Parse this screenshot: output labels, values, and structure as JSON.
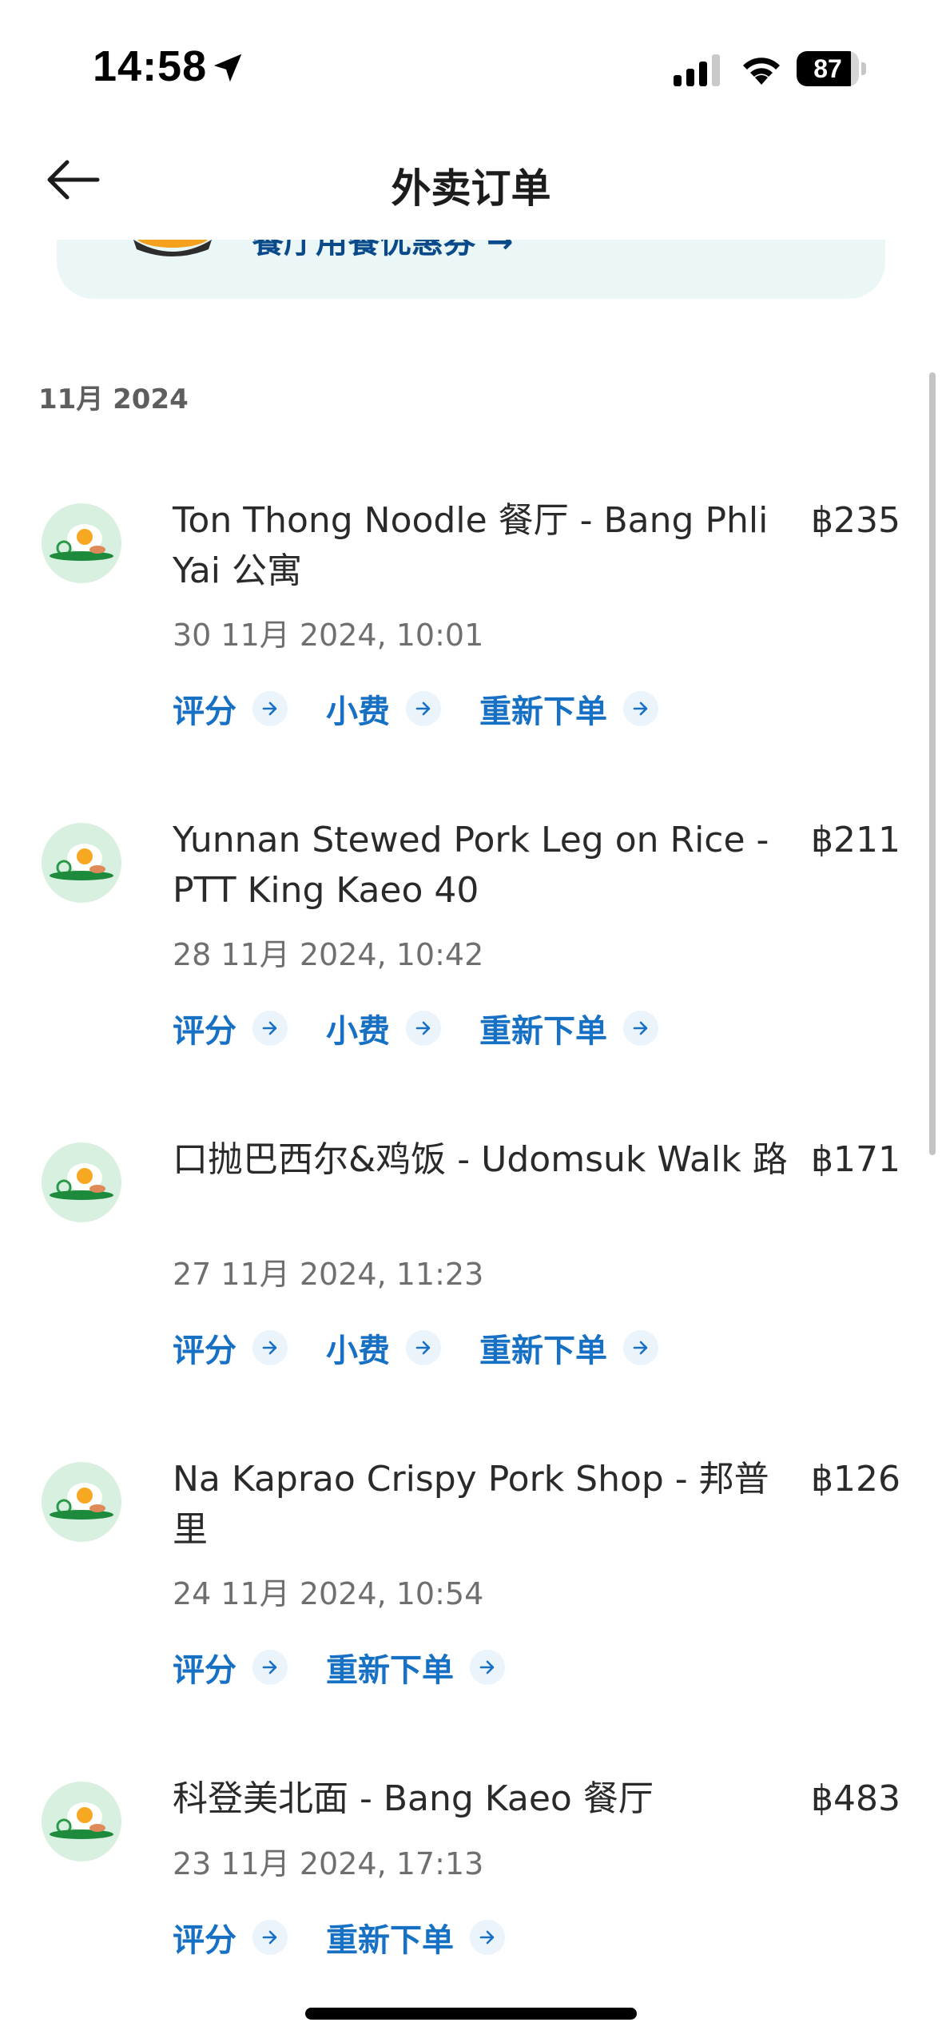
{
  "status_bar": {
    "time": "14:58",
    "battery": "87",
    "battery_level_fraction": 0.87
  },
  "header": {
    "title": "外卖订单"
  },
  "promo": {
    "text": "餐厅用餐优惠券 →"
  },
  "month_label": "11月 2024",
  "orders": [
    {
      "title": "Ton Thong Noodle 餐厅 - Bang Phli Yai 公寓",
      "price": "฿235",
      "date": "30 11月 2024, 10:01",
      "actions": [
        "评分",
        "小费",
        "重新下单"
      ]
    },
    {
      "title": "Yunnan Stewed Pork Leg on Rice - PTT King Kaeo 40",
      "price": "฿211",
      "date": "28 11月 2024, 10:42",
      "actions": [
        "评分",
        "小费",
        "重新下单"
      ]
    },
    {
      "title": "口抛巴西尔&鸡饭 - Udomsuk Walk 路",
      "price": "฿171",
      "date": "27 11月 2024, 11:23",
      "actions": [
        "评分",
        "小费",
        "重新下单"
      ]
    },
    {
      "title": "Na Kaprao Crispy Pork Shop - 邦普里",
      "price": "฿126",
      "date": "24 11月 2024, 10:54",
      "actions": [
        "评分",
        "重新下单"
      ]
    },
    {
      "title": "科登美北面 - Bang Kaeo 餐厅",
      "price": "฿483",
      "date": "23 11月 2024, 17:13",
      "actions": [
        "评分",
        "重新下单"
      ]
    }
  ],
  "colors": {
    "accent": "#1670c4",
    "banner_bg": "#eaf7f6",
    "avatar_bg": "#d7f0e0"
  }
}
